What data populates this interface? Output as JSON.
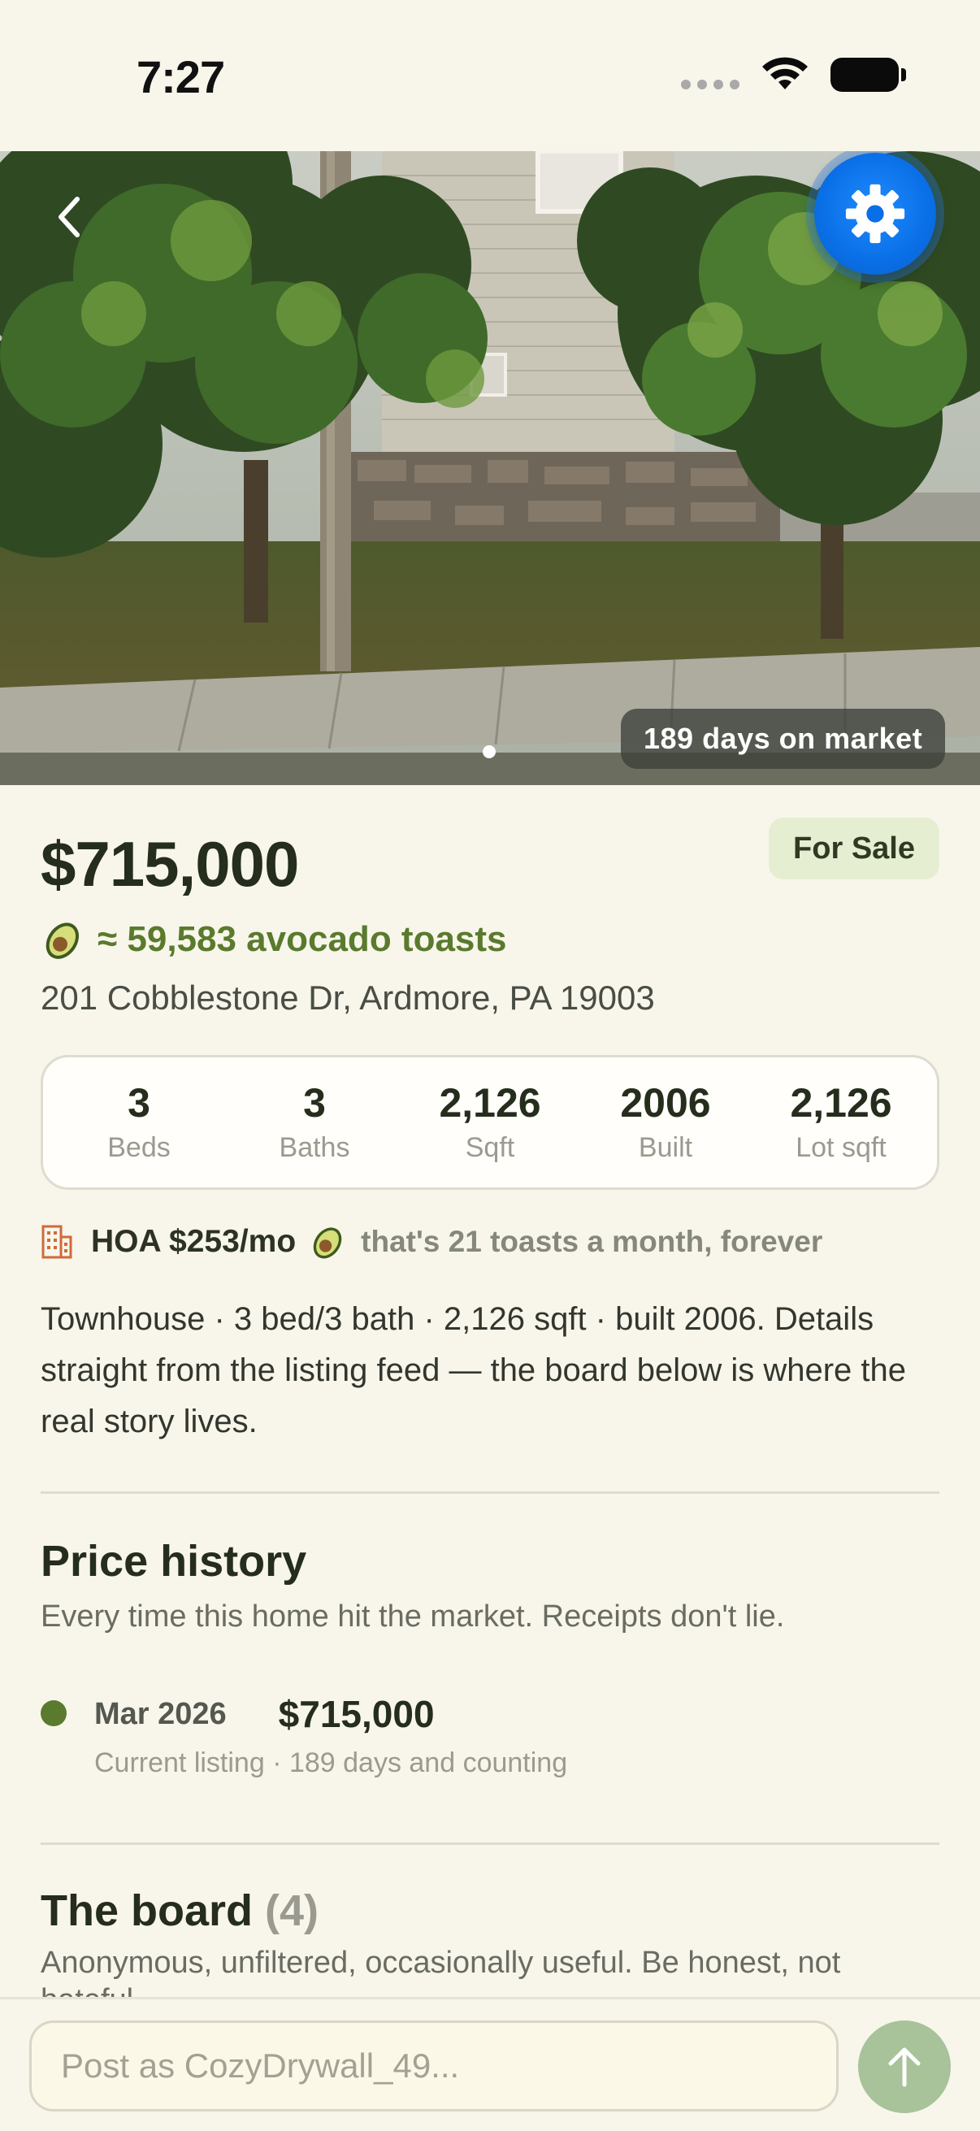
{
  "status_bar": {
    "time": "7:27"
  },
  "hero": {
    "days_on_market_badge": "189 days on market",
    "photo_page": 1,
    "photo_count": 1
  },
  "listing": {
    "price": "$715,000",
    "status": "For Sale",
    "avocado_line": "≈ 59,583 avocado toasts",
    "address": "201 Cobblestone Dr, Ardmore, PA 19003"
  },
  "stats": [
    {
      "value": "3",
      "label": "Beds"
    },
    {
      "value": "3",
      "label": "Baths"
    },
    {
      "value": "2,126",
      "label": "Sqft"
    },
    {
      "value": "2006",
      "label": "Built"
    },
    {
      "value": "2,126",
      "label": "Lot sqft"
    }
  ],
  "hoa": {
    "label": "HOA $253/mo",
    "note": "that's 21 toasts a month, forever"
  },
  "description": "Townhouse · 3 bed/3 bath · 2,126 sqft · built 2006. Details straight from the listing feed — the board below is where the real story lives.",
  "price_history": {
    "title": "Price history",
    "subtitle": "Every time this home hit the market. Receipts don't lie.",
    "items": [
      {
        "date": "Mar 2026",
        "price": "$715,000",
        "note": "Current listing · 189 days and counting"
      }
    ]
  },
  "board": {
    "title": "The board",
    "count": "(4)",
    "subtitle": "Anonymous, unfiltered, occasionally useful. Be honest, not hateful."
  },
  "composer": {
    "placeholder": "Post as CozyDrywall_49..."
  },
  "colors": {
    "background": "#f8f6ea",
    "accent_green": "#5a7a2e",
    "settings_blue": "#0a6fe6",
    "send_button": "#a8c29a"
  },
  "icons": {
    "back": "chevron-left-icon",
    "settings": "gear-icon",
    "hoa": "building-icon",
    "avocado": "avocado-icon",
    "send": "arrow-up-icon"
  }
}
